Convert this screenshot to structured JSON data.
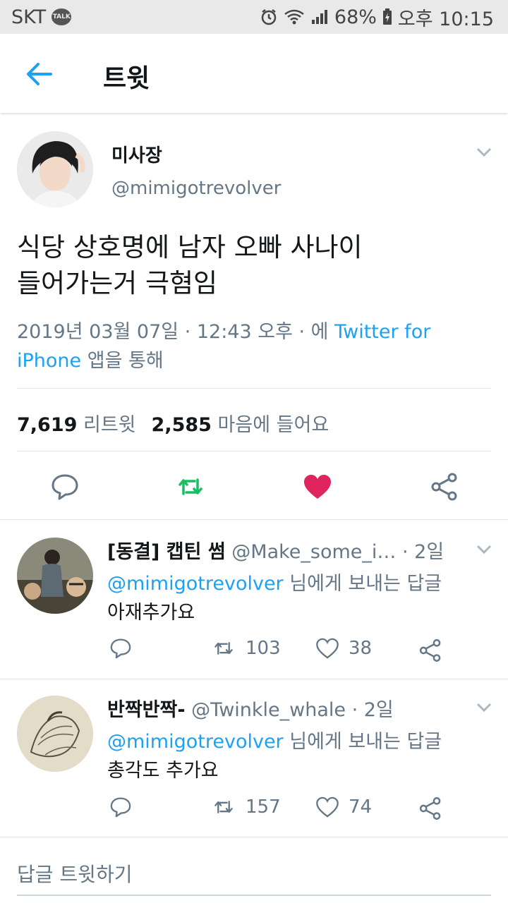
{
  "status": {
    "carrier": "SKT",
    "talk": "TALK",
    "battery": "68%",
    "time": "오후 10:15"
  },
  "appbar": {
    "title": "트윗"
  },
  "tweet": {
    "name": "미사장",
    "handle": "@mimigotrevolver",
    "line1": "식당 상호명에 남자 오빠 사나이",
    "line2": "들어가는거 극혐임",
    "date": "2019년 03월 07일 · 12:43 오후 · 에 ",
    "source_a": "Twitter for",
    "source_b": "iPhone",
    "source_suffix": " 앱을 통해",
    "retweets": "7,619",
    "retweets_label": "리트윗",
    "likes": "2,585",
    "likes_label": "마음에 들어요"
  },
  "replies": [
    {
      "name": "[동결] 캡틴 썸",
      "handle": "@Make_some_i…",
      "time": " · 2일",
      "to_handle": "@mimigotrevolver",
      "to_suffix": " 님에게 보내는 답글",
      "text": "아재추가요",
      "retweets": "103",
      "likes": "38"
    },
    {
      "name": "반짝반짝-",
      "handle": "@Twinkle_whale",
      "time": " · 2일",
      "to_handle": "@mimigotrevolver",
      "to_suffix": " 님에게 보내는 답글",
      "text": "총각도 추가요",
      "retweets": "157",
      "likes": "74"
    }
  ],
  "compose": {
    "placeholder": "답글 트윗하기"
  },
  "colors": {
    "accent": "#1da1f2",
    "retweet": "#17bf63",
    "like": "#e0245e",
    "muted": "#657786"
  }
}
